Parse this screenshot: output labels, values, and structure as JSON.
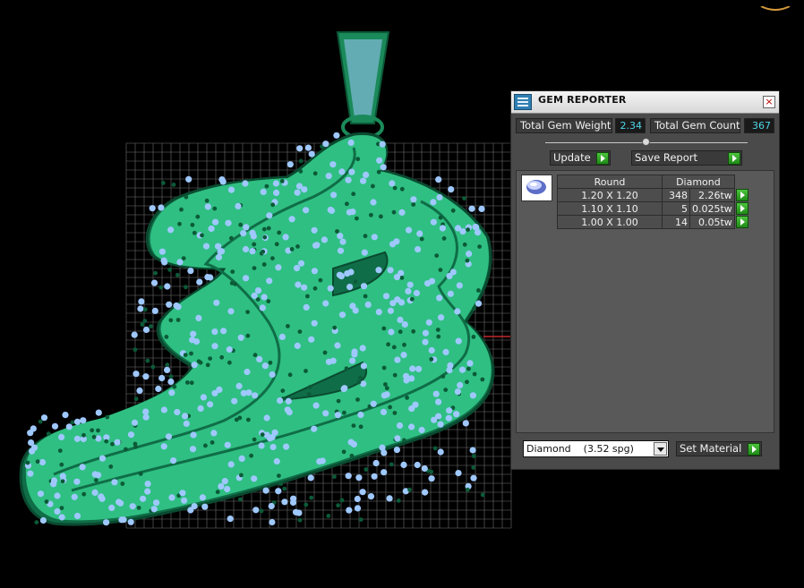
{
  "panel": {
    "title": "GEM REPORTER",
    "close_glyph": "×",
    "total_gem_weight_label": "Total Gem Weight",
    "total_gem_weight": "2.34",
    "total_gem_count_label": "Total Gem Count",
    "total_gem_count": "367",
    "update_label": "Update",
    "save_report_label": "Save Report",
    "material_value": "Diamond    (3.52 spg)",
    "set_material_label": "Set Material"
  },
  "table": {
    "shape_header": "Round",
    "material_header": "Diamond",
    "rows": [
      {
        "size": "1.20 X 1.20",
        "count": "348",
        "weight": "2.26tw"
      },
      {
        "size": "1.10 X 1.10",
        "count": "5",
        "weight": "0.025tw"
      },
      {
        "size": "1.00 X 1.00",
        "count": "14",
        "weight": "0.05tw"
      }
    ]
  },
  "colors": {
    "background": "#000000",
    "grid": "#6e6e6e",
    "metal_green": "#2fbf82",
    "gem_blue": "#9fc8ff",
    "value_cyan": "#4fd6e8",
    "axis_red": "#c0282a"
  },
  "icons": [
    "gem-reporter-icon",
    "close-icon",
    "go-arrow-icon",
    "dropdown-arrow-icon",
    "round-gem-icon"
  ]
}
